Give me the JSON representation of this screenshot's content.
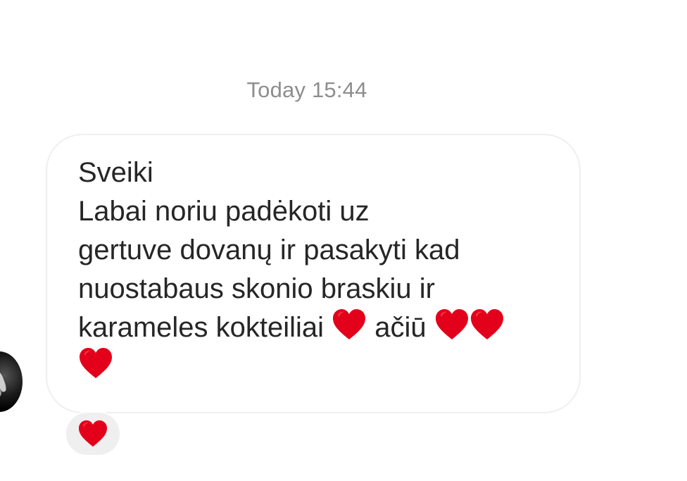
{
  "timestamp": "Today 15:44",
  "message": {
    "lines": [
      "Sveiki",
      "Labai noriu padėkoti uz",
      "gertuve dovanų ir pasakyti kad",
      "nuostabaus skonio braskiu ir",
      "karameles kokteiliai",
      "ačiū"
    ]
  },
  "icons": {
    "heart": "red-heart-icon",
    "avatar": "sender-avatar"
  },
  "reaction": {
    "emoji": "red-heart-icon"
  },
  "colors": {
    "heart": "#e3001b",
    "bubble_border": "#efefef",
    "timestamp": "#8e8e8e",
    "text": "#262626",
    "reaction_bg": "#efefef"
  }
}
